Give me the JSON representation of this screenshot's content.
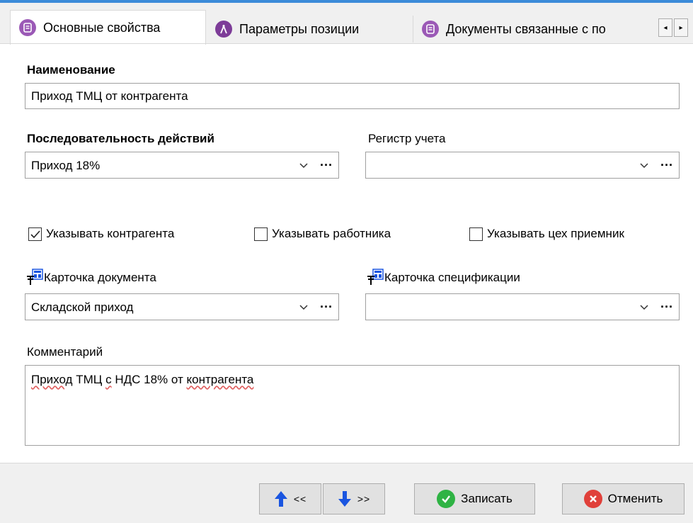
{
  "tabs": [
    {
      "label": "Основные свойства",
      "icon": "document-icon",
      "color": "#9b59b6"
    },
    {
      "label": "Параметры позиции",
      "icon": "compass-icon",
      "color": "#7d3c98"
    },
    {
      "label": "Документы связанные с по",
      "icon": "document-icon",
      "color": "#9b59b6"
    }
  ],
  "scroll": {
    "left": "◂",
    "right": "▸"
  },
  "form": {
    "name_label": "Наименование",
    "name_value": "Приход ТМЦ от контрагента",
    "sequence_label": "Последовательность действий",
    "sequence_value": "Приход 18%",
    "register_label": "Регистр учета",
    "register_value": "",
    "dots": "···",
    "checkboxes": [
      {
        "label": "Указывать контрагента",
        "checked": true
      },
      {
        "label": "Указывать работника",
        "checked": false
      },
      {
        "label": "Указывать цех приемник",
        "checked": false
      }
    ],
    "doc_card_label": "Карточка документа",
    "doc_card_value": "Складской приход",
    "spec_card_label": "Карточка спецификации",
    "spec_card_value": "",
    "comment_label": "Комментарий",
    "comment_words": [
      "Приход",
      "ТМЦ",
      "с",
      "НДС",
      "18%",
      "от",
      "контрагента"
    ]
  },
  "footer": {
    "prev_label": "<<",
    "next_label": ">>",
    "save_label": "Записать",
    "cancel_label": "Отменить"
  },
  "colors": {
    "accent_blue": "#1a55e0",
    "save_green": "#2fb344",
    "cancel_red": "#e0403a",
    "tab_strip_top": "#3c8bd9"
  }
}
